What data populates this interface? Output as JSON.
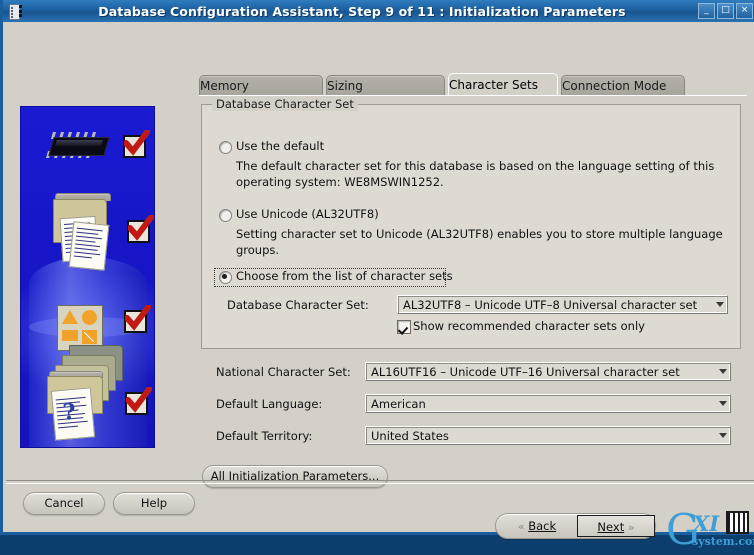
{
  "window": {
    "title": "Database Configuration Assistant, Step 9 of 11 : Initialization Parameters",
    "minimize_label": "_",
    "maximize_label": "□",
    "close_label": "×",
    "app_icon": "database-chip-icon"
  },
  "tabs": [
    {
      "label": "Memory",
      "active": false
    },
    {
      "label": "Sizing",
      "active": false
    },
    {
      "label": "Character Sets",
      "active": true
    },
    {
      "label": "Connection Mode",
      "active": false
    }
  ],
  "groupbox": {
    "title": "Database Character Set",
    "options": [
      {
        "id": "use-default",
        "label": "Use the default",
        "selected": false,
        "description_line1": "The default character set for this database is based on the language setting of this",
        "description_line2": "operating system: WE8MSWIN1252."
      },
      {
        "id": "use-unicode",
        "label": "Use Unicode (AL32UTF8)",
        "selected": false,
        "description_line1": "Setting character set to Unicode (AL32UTF8) enables you to store multiple language",
        "description_line2": "groups."
      },
      {
        "id": "choose-from-list",
        "label": "Choose from the list of character sets",
        "selected": true
      }
    ],
    "database_charset": {
      "label": "Database Character Set:",
      "value": "AL32UTF8 – Unicode UTF–8 Universal character set"
    },
    "recommended_checkbox": {
      "label": "Show recommended character sets only",
      "checked": true
    }
  },
  "fields": [
    {
      "label": "National Character Set:",
      "value": "AL16UTF16 – Unicode UTF–16 Universal character set"
    },
    {
      "label": "Default Language:",
      "value": "American"
    },
    {
      "label": "Default Territory:",
      "value": "United States"
    }
  ],
  "buttons": {
    "all_init_params": "All Initialization Parameters...",
    "cancel": "Cancel",
    "help": "Help",
    "back": "Back",
    "next": "Next",
    "back_chevron": "«",
    "next_chevron": "»"
  },
  "watermark": {
    "g": "G",
    "xi": "XI",
    "domain": "system.com"
  },
  "colors": {
    "titlebar": "#1c5f9e",
    "window_bg": "#d4d0c8",
    "group_bg": "#dedad2",
    "art_bg": "#1616c8",
    "accent_orange": "#f0a22a",
    "check_red": "#c01a15",
    "watermark_blue": "#3d9fd6"
  }
}
